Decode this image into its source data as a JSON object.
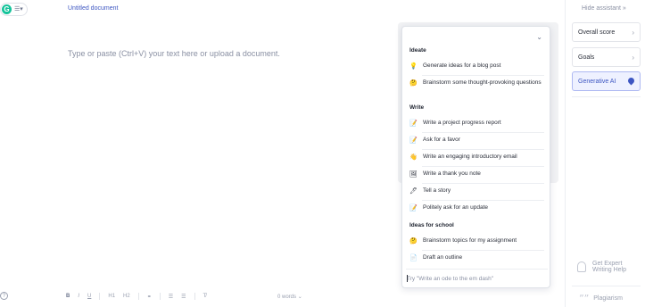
{
  "document": {
    "title": "Untitled document",
    "placeholder": "Type or paste (Ctrl+V) your text here or upload a document."
  },
  "toolbar": {
    "bold": "B",
    "italic": "I",
    "underline": "U",
    "h1": "H1",
    "h2": "H2",
    "link": "⚭",
    "ordered_list": "☰",
    "bullet_list": "☰",
    "clear_format": "T̸",
    "word_count": "0 words",
    "word_count_chevron": "⌄",
    "help": "?"
  },
  "sidebar": {
    "hide_assistant": "Hide assistant",
    "hide_chevron": "»",
    "cards": [
      {
        "label": "Overall score",
        "chevron": "›"
      },
      {
        "label": "Goals",
        "chevron": "›"
      },
      {
        "label": "Generative AI"
      }
    ],
    "expert_help": [
      "Get Expert",
      "Writing Help"
    ],
    "plagiarism": "Plagiarism",
    "plagiarism_icon": "””"
  },
  "panel": {
    "chevron": "⌄",
    "sections": [
      {
        "title": "Ideate",
        "items": [
          {
            "icon": "💡",
            "icon_name": "lightbulb-icon",
            "label": "Generate ideas for a blog post"
          },
          {
            "icon": "🤔",
            "icon_name": "thinking-face-icon",
            "label": "Brainstorm some thought-provoking questions"
          }
        ]
      },
      {
        "title": "Write",
        "items": [
          {
            "icon": "📝",
            "icon_name": "pencil-icon",
            "label": "Write a project progress report"
          },
          {
            "icon": "📝",
            "icon_name": "pencil-icon",
            "label": "Ask for a favor"
          },
          {
            "icon": "👋",
            "icon_name": "waving-hand-icon",
            "label": "Write an engaging introductory email"
          },
          {
            "icon": "🖼",
            "icon_name": "card-icon",
            "label": "Write a thank you note"
          },
          {
            "icon": "🖊",
            "icon_name": "pen-icon",
            "label": "Tell a story"
          },
          {
            "icon": "📝",
            "icon_name": "pencil-icon",
            "label": "Politely ask for an update"
          }
        ]
      },
      {
        "title": "Ideas for school",
        "items": [
          {
            "icon": "🤔",
            "icon_name": "thinking-face-icon",
            "label": "Brainstorm topics for my assignment"
          },
          {
            "icon": "📄",
            "icon_name": "document-icon",
            "label": "Draft an outline"
          }
        ]
      }
    ],
    "prompt_placeholder": "Try \"Write an ode to the em dash\""
  },
  "colors": {
    "accent": "#3d56c2",
    "brand_green": "#15c39a",
    "active_card_bg": "#eef1ff"
  }
}
